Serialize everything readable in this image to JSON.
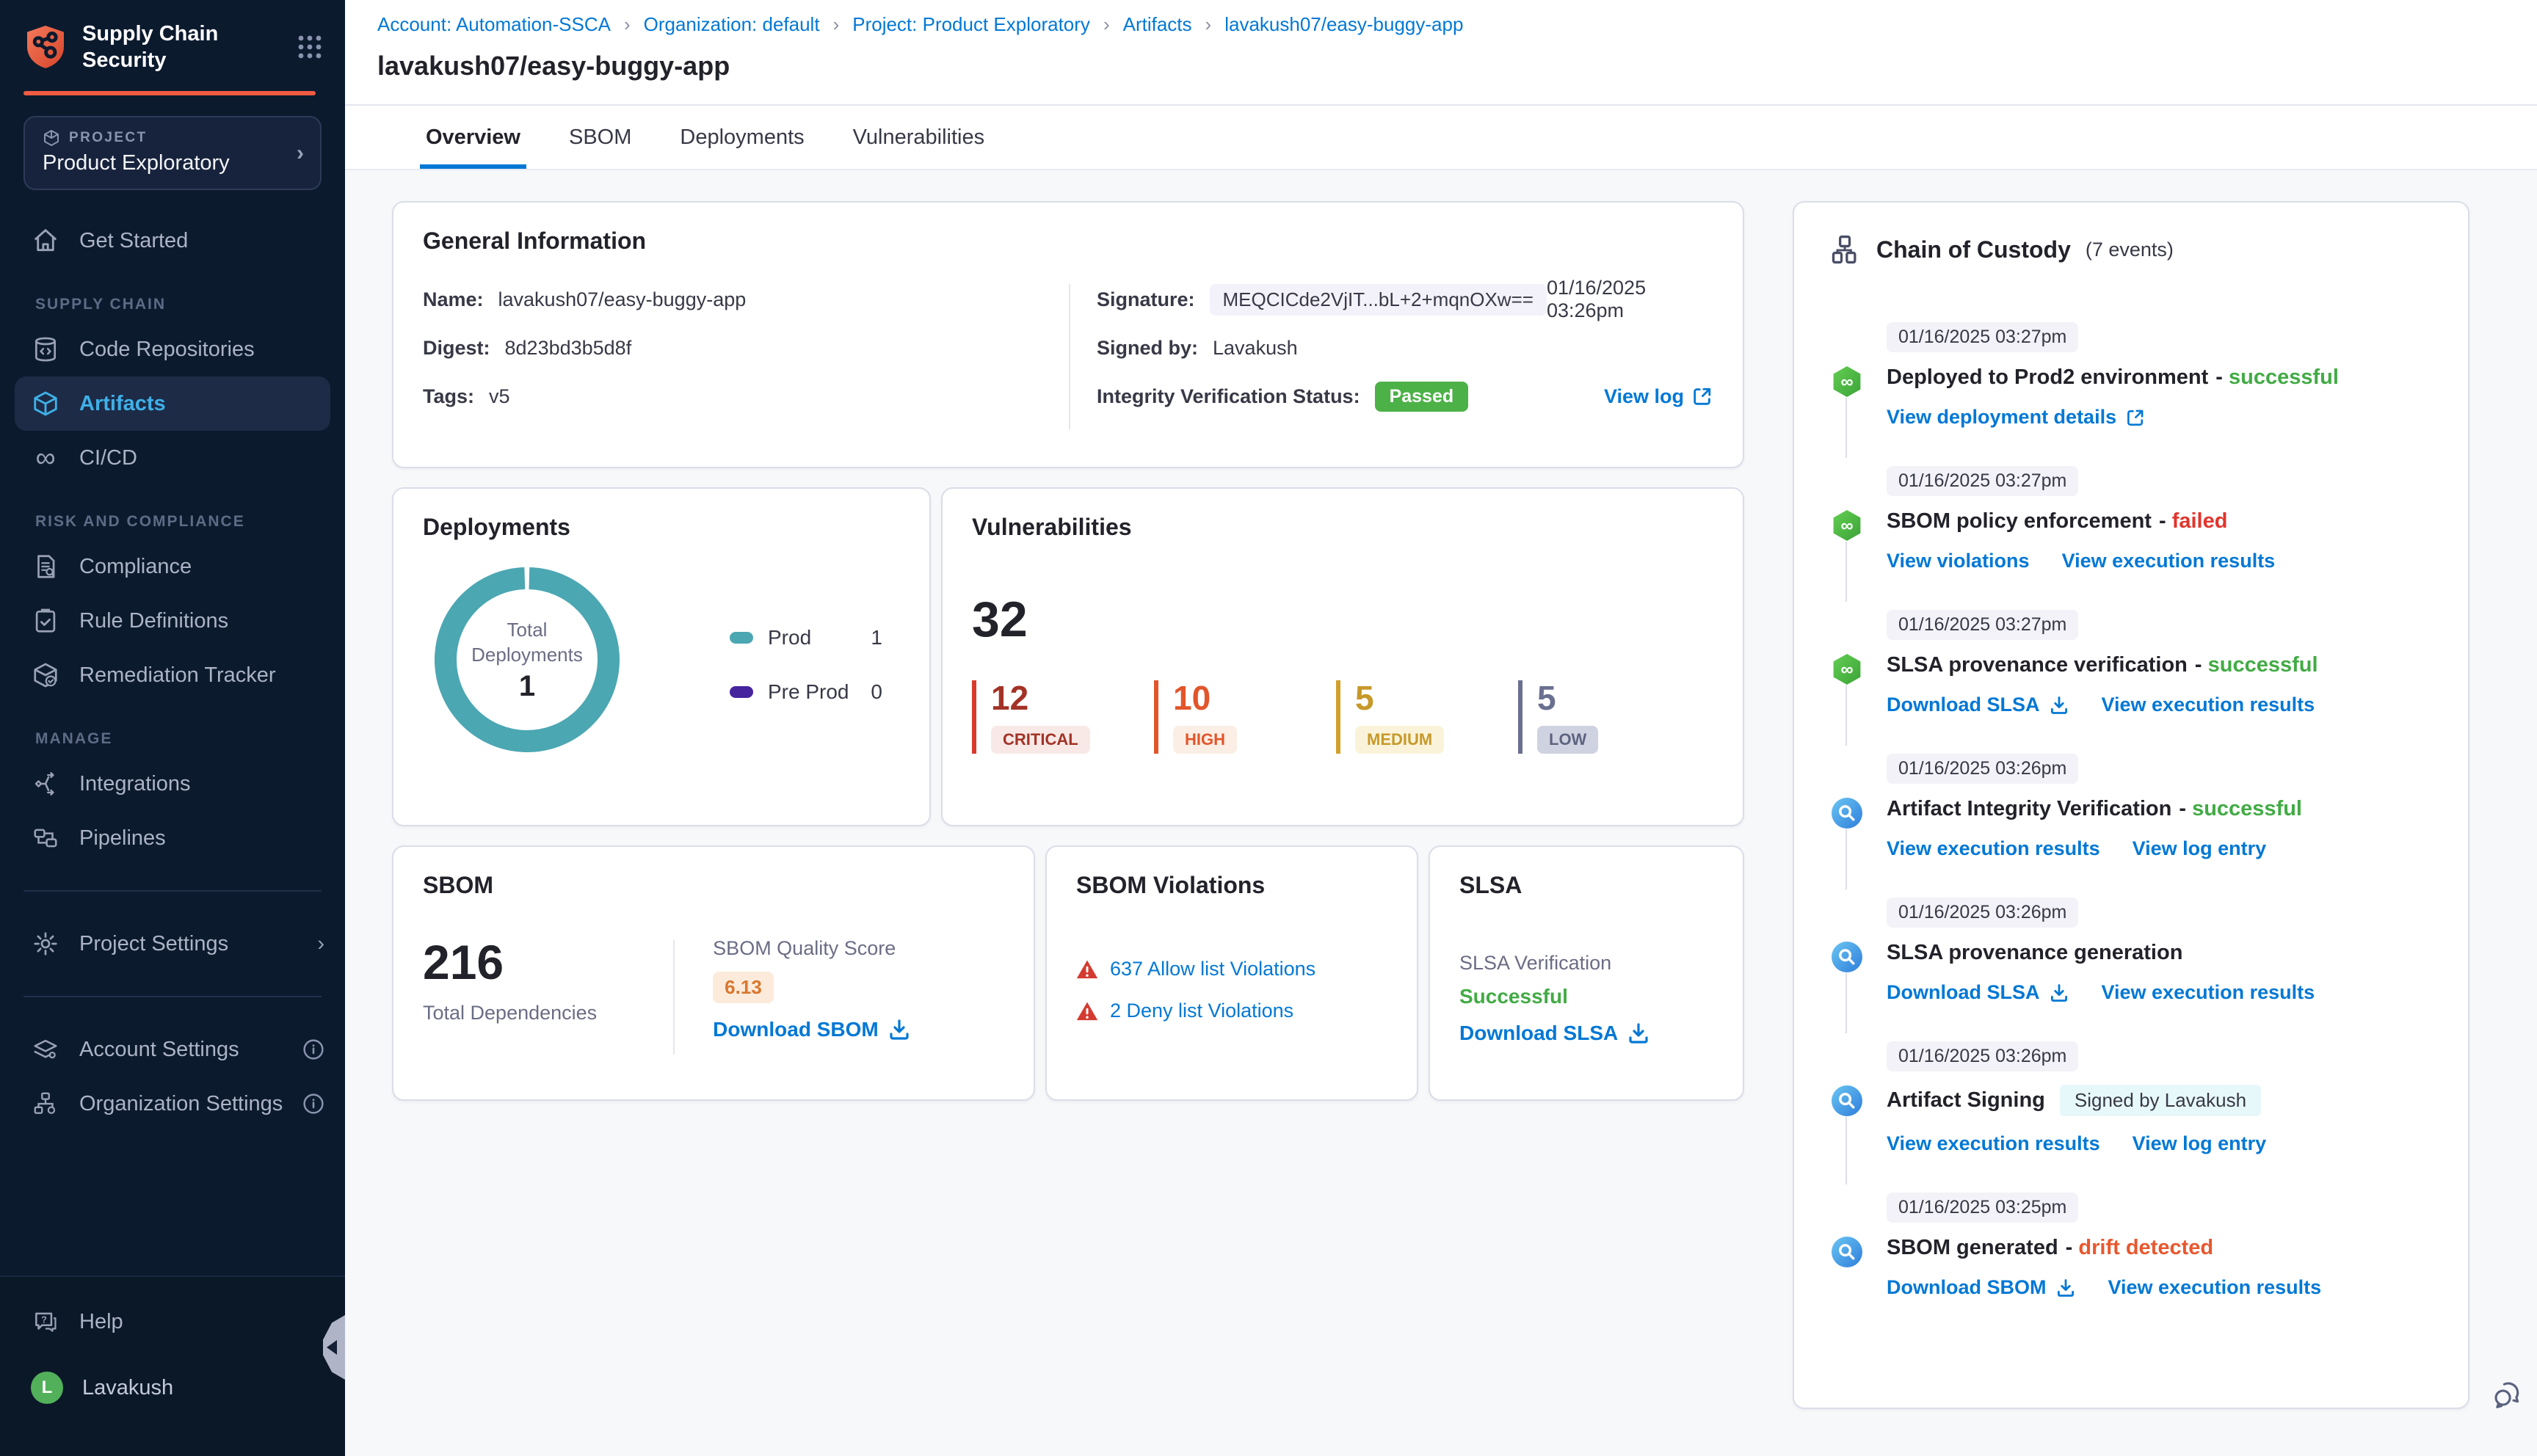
{
  "app": {
    "logo_line1": "Supply Chain",
    "logo_line2": "Security"
  },
  "sidebar": {
    "project": {
      "kicker": "PROJECT",
      "name": "Product Exploratory"
    },
    "get_started": "Get Started",
    "sections": [
      {
        "label": "SUPPLY CHAIN",
        "items": [
          "Code Repositories",
          "Artifacts",
          "CI/CD"
        ]
      },
      {
        "label": "RISK AND COMPLIANCE",
        "items": [
          "Compliance",
          "Rule Definitions",
          "Remediation Tracker"
        ]
      },
      {
        "label": "MANAGE",
        "items": [
          "Integrations",
          "Pipelines"
        ]
      }
    ],
    "project_settings": "Project Settings",
    "account_settings": "Account Settings",
    "organization_settings": "Organization Settings",
    "help": "Help",
    "user": {
      "initial": "L",
      "name": "Lavakush"
    }
  },
  "breadcrumb": {
    "items": [
      "Account: Automation-SSCA",
      "Organization: default",
      "Project: Product Exploratory",
      "Artifacts",
      "lavakush07/easy-buggy-app"
    ]
  },
  "page": {
    "title": "lavakush07/easy-buggy-app",
    "tabs": [
      {
        "label": "Overview",
        "active": true
      },
      {
        "label": "SBOM",
        "active": false
      },
      {
        "label": "Deployments",
        "active": false
      },
      {
        "label": "Vulnerabilities",
        "active": false
      }
    ]
  },
  "general_info": {
    "title": "General Information",
    "name_label": "Name:",
    "name": "lavakush07/easy-buggy-app",
    "digest_label": "Digest:",
    "digest": "8d23bd3b5d8f",
    "tags_label": "Tags:",
    "tags": "v5",
    "signature_label": "Signature:",
    "signature": "MEQCICde2VjIT...bL+2+mqnOXw==",
    "signature_time": "01/16/2025 03:26pm",
    "signed_by_label": "Signed by:",
    "signed_by": "Lavakush",
    "integrity_label": "Integrity Verification Status:",
    "integrity_status": "Passed",
    "view_log": "View log"
  },
  "deployments": {
    "title": "Deployments",
    "center_label_line1": "Total",
    "center_label_line2": "Deployments",
    "total": "1",
    "legend": [
      {
        "label": "Prod",
        "value": "1",
        "color": "#4BA7B2"
      },
      {
        "label": "Pre Prod",
        "value": "0",
        "color": "#45249E"
      }
    ]
  },
  "vulnerabilities": {
    "title": "Vulnerabilities",
    "total": "32",
    "severities": [
      {
        "label": "CRITICAL",
        "count": "12",
        "color": "#A33226"
      },
      {
        "label": "HIGH",
        "count": "10",
        "color": "#E2552B"
      },
      {
        "label": "MEDIUM",
        "count": "5",
        "color": "#C7992A"
      },
      {
        "label": "LOW",
        "count": "5",
        "color": "#6A7090"
      }
    ]
  },
  "sbom": {
    "title": "SBOM",
    "total": "216",
    "total_label": "Total Dependencies",
    "quality_label": "SBOM Quality Score",
    "quality_score": "6.13",
    "download_label": "Download SBOM",
    "download_icon": "download-icon"
  },
  "sbom_violations": {
    "title": "SBOM Violations",
    "items": [
      {
        "icon": "warning-icon",
        "label": "637 Allow list Violations"
      },
      {
        "icon": "warning-icon",
        "label": "2 Deny list Violations"
      }
    ]
  },
  "slsa": {
    "title": "SLSA",
    "verification_label": "SLSA Verification",
    "status": "Successful",
    "download_label": "Download SLSA",
    "download_icon": "download-icon"
  },
  "custody": {
    "title": "Chain of Custody",
    "count_label": "(7 events)",
    "events": [
      {
        "timestamp": "01/16/2025 03:27pm",
        "icon": "pipeline-icon",
        "title": "Deployed to Prod2 environment",
        "status": "successful",
        "status_color": "green",
        "links": [
          {
            "label": "View deployment details",
            "icon": "external-link-icon"
          }
        ]
      },
      {
        "timestamp": "01/16/2025 03:27pm",
        "icon": "pipeline-icon",
        "title": "SBOM policy enforcement",
        "status": "failed",
        "status_color": "red",
        "links": [
          {
            "label": "View violations"
          },
          {
            "label": "View execution results"
          }
        ]
      },
      {
        "timestamp": "01/16/2025 03:27pm",
        "icon": "pipeline-icon",
        "title": "SLSA provenance verification",
        "status": "successful",
        "status_color": "green",
        "links": [
          {
            "label": "Download SLSA",
            "icon": "download-icon"
          },
          {
            "label": "View execution results"
          }
        ]
      },
      {
        "timestamp": "01/16/2025 03:26pm",
        "icon": "scan-icon",
        "title": "Artifact Integrity Verification",
        "status": "successful",
        "status_color": "green",
        "links": [
          {
            "label": "View execution results"
          },
          {
            "label": "View log entry"
          }
        ]
      },
      {
        "timestamp": "01/16/2025 03:26pm",
        "icon": "scan-icon",
        "title": "SLSA provenance generation",
        "status": "",
        "status_color": "",
        "links": [
          {
            "label": "Download SLSA",
            "icon": "download-icon"
          },
          {
            "label": "View execution results"
          }
        ]
      },
      {
        "timestamp": "01/16/2025 03:26pm",
        "icon": "scan-icon",
        "title": "Artifact Signing",
        "status": "",
        "status_color": "",
        "badge": "Signed by Lavakush",
        "links": [
          {
            "label": "View execution results"
          },
          {
            "label": "View log entry"
          }
        ]
      },
      {
        "timestamp": "01/16/2025 03:25pm",
        "icon": "scan-icon",
        "title": "SBOM generated",
        "status": "drift detected",
        "status_color": "orange",
        "links": [
          {
            "label": "Download SBOM",
            "icon": "download-icon"
          },
          {
            "label": "View execution results"
          }
        ]
      }
    ]
  },
  "colors": {
    "accent_blue": "#0278D5",
    "brand_orange": "#EE5C42",
    "sidebar_bg": "#0C1A2E",
    "passed_green": "#4CB147",
    "success_green": "#42AB45",
    "failed_red": "#E0352C",
    "drift_orange": "#E8582F",
    "donut_teal": "#4BA7B2",
    "preprod_purple": "#45249E",
    "quality_orange": "#D9772F"
  }
}
